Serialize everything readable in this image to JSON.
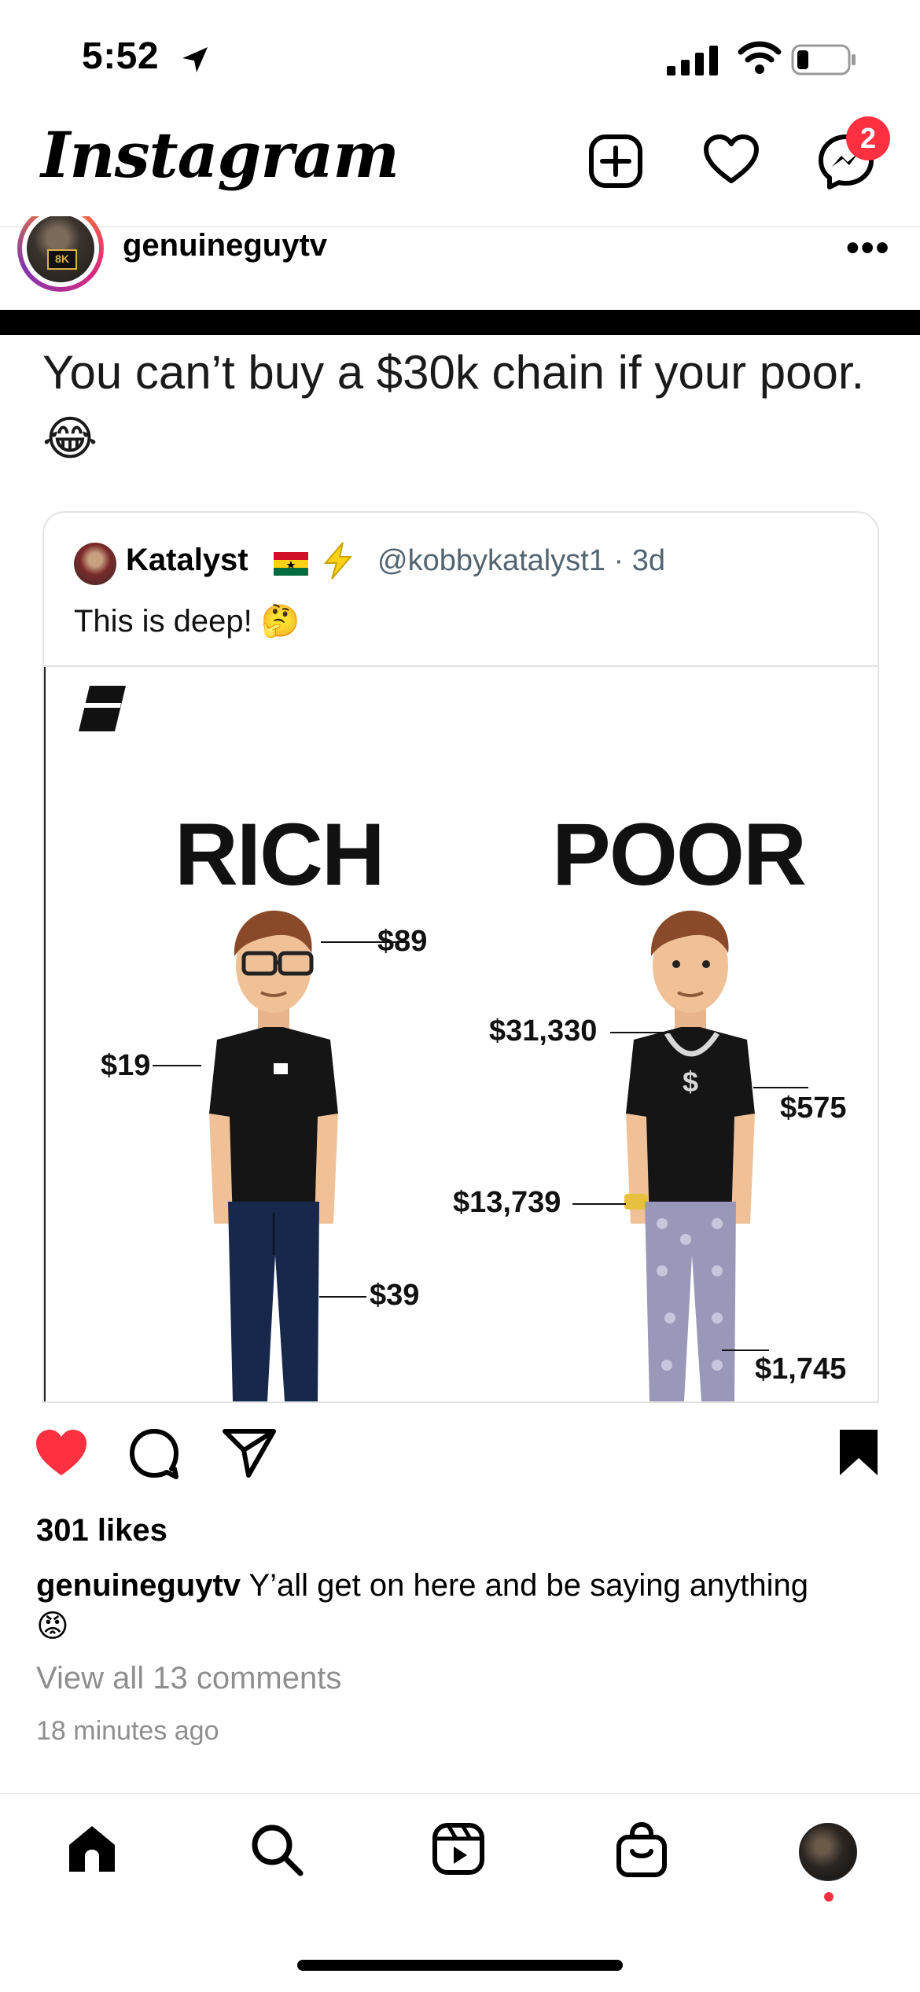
{
  "status_bar": {
    "time": "5:52"
  },
  "header": {
    "logo": "Instagram",
    "messages_badge": "2"
  },
  "post": {
    "username": "genuineguytv",
    "avatar_tag": "8K",
    "text": "You can’t buy a $30k chain if your poor. 😂",
    "quote": {
      "name": "Katalyst",
      "handle": "@kobbykatalyst1 · 3d",
      "body": "This is deep! 🤔"
    },
    "meme": {
      "rich_label": "RICH",
      "poor_label": "POOR",
      "rich_prices": {
        "glasses": "$89",
        "shirt": "$19",
        "jeans": "$39"
      },
      "poor_prices": {
        "chain": "$31,330",
        "shirt": "$575",
        "watch": "$13,739",
        "pants": "$1,745"
      }
    }
  },
  "engagement": {
    "likes": "301 likes",
    "caption_user": "genuineguytv",
    "caption_text": " Y’all get on here and be saying anything",
    "caption_emoji": "😡",
    "view_comments": "View all 13 comments",
    "time_ago": "18 minutes ago"
  },
  "colors": {
    "like_red": "#ff3040",
    "muted": "#8e8e8e",
    "handle_gray": "#536471"
  }
}
